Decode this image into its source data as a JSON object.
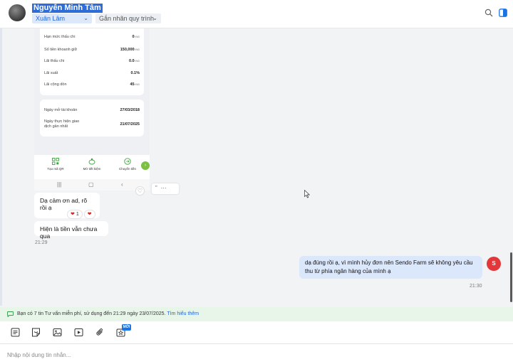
{
  "header": {
    "contact_name": "Nguyễn Minh Tâm",
    "assignee": "Xuân Lâm",
    "label_placeholder": "Gắn nhãn quy trình"
  },
  "screenshot": {
    "rows": [
      {
        "label": "Hạn mức thấu chi",
        "value": "0",
        "unit": "VND"
      },
      {
        "label": "Số tiền khoanh giữ",
        "value": "150,000",
        "unit": "VND"
      },
      {
        "label": "Lãi thấu chi",
        "value": "0.0",
        "unit": "VND"
      },
      {
        "label": "Lãi suất",
        "value": "0.1%",
        "unit": ""
      },
      {
        "label": "Lãi cộng dồn",
        "value": "45",
        "unit": "VND"
      }
    ],
    "dates": [
      {
        "label": "Ngày mở tài khoản",
        "value": "27/03/2018"
      },
      {
        "label_line1": "Ngày thực hiện giao",
        "label_line2": "dịch gần nhất",
        "value": "21/07/2025"
      }
    ],
    "nav": [
      "Tạo mã QR",
      "Mở tiết kiệm",
      "Chuyển tiền"
    ]
  },
  "messages": {
    "in_1": "Dạ cảm ơn ad, rõ rồi ạ",
    "reaction_count": "1",
    "in_2": "Hiện là tiền vẫn chưa qua",
    "time_in": "21:29",
    "out_1": "dạ đúng rồi ạ, vì mình hủy đơn nên Sendo Farm sẽ không yêu cầu thu từ phía ngân hàng của mình ạ",
    "time_out": "21:30"
  },
  "notice": {
    "text": "Bạn có 7 tin Tư vấn miễn phí, sử dụng đến 21:29 ngày 23/07/2025.",
    "link": "Tìm hiểu thêm"
  },
  "toolbar": {
    "new_badge": "MỚI"
  },
  "composer": {
    "placeholder": "Nhập nội dung tin nhắn..."
  },
  "colors": {
    "accent": "#2466d4",
    "outgoing_bubble": "#dbe7fb",
    "notice_bg": "#e7f6e9",
    "reaction_heart": "#e02424"
  }
}
